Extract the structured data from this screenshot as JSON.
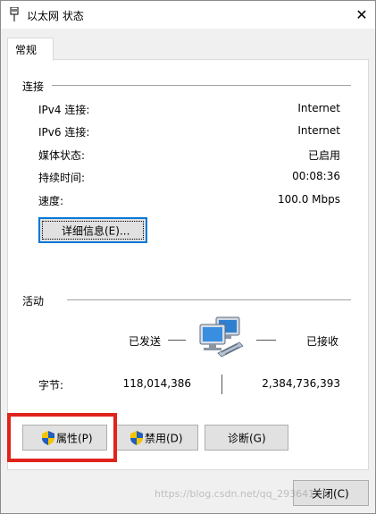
{
  "window": {
    "title": "以太网 状态",
    "close_glyph": "✕"
  },
  "tabs": [
    {
      "label": "常规"
    }
  ],
  "connection": {
    "section_title": "连接",
    "rows": [
      {
        "label": "IPv4 连接:",
        "value": "Internet"
      },
      {
        "label": "IPv6 连接:",
        "value": "Internet"
      },
      {
        "label": "媒体状态:",
        "value": "已启用"
      },
      {
        "label": "持续时间:",
        "value": "00:08:36"
      },
      {
        "label": "速度:",
        "value": "100.0 Mbps"
      }
    ],
    "details_button": "详细信息(E)..."
  },
  "activity": {
    "section_title": "活动",
    "sent_label": "已发送",
    "received_label": "已接收",
    "bytes_label": "字节:",
    "sent_bytes": "118,014,386",
    "received_bytes": "2,384,736,393",
    "icon": "network-computers-icon"
  },
  "actions": {
    "properties": "属性(P)",
    "disable": "禁用(D)",
    "diagnose": "诊断(G)",
    "close": "关闭(C)"
  },
  "watermark": "https://blog.csdn.net/qq_29364161",
  "colors": {
    "highlight": "#e0231b",
    "focus_border": "#0078d7",
    "shield_blue": "#1f5fbf",
    "shield_yellow": "#f5c400"
  }
}
